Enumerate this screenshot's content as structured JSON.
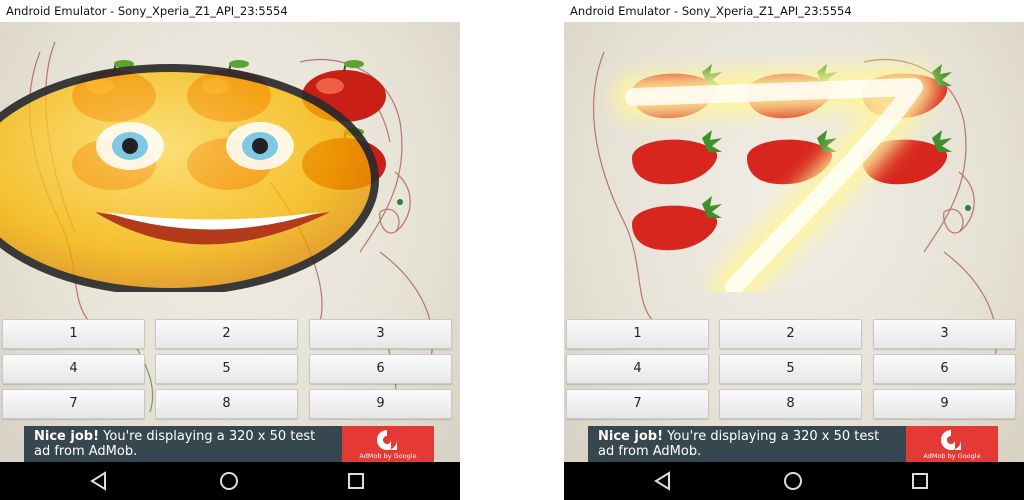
{
  "emulators": [
    {
      "title": "Android Emulator - Sony_Xperia_Z1_API_23:5554",
      "keypad": [
        "1",
        "2",
        "3",
        "4",
        "5",
        "6",
        "7",
        "8",
        "9"
      ],
      "ad": {
        "headline": "Nice job!",
        "body": "You're displaying a 320 x 50 test ad from AdMob.",
        "logo_text": "AdMob by Google"
      },
      "fruit": "apple",
      "fruit_count": 6,
      "overlay": "smiley-face"
    },
    {
      "title": "Android Emulator - Sony_Xperia_Z1_API_23:5554",
      "keypad": [
        "1",
        "2",
        "3",
        "4",
        "5",
        "6",
        "7",
        "8",
        "9"
      ],
      "ad": {
        "headline": "Nice job!",
        "body": "You're displaying a 320 x 50 test ad from AdMob.",
        "logo_text": "AdMob by Google"
      },
      "fruit": "strawberry",
      "fruit_count": 7,
      "overlay": "glowing-number-seven"
    }
  ],
  "nav": {
    "back_icon": "back-triangle-icon",
    "home_icon": "home-circle-icon",
    "recents_icon": "recents-square-icon"
  },
  "colors": {
    "ad_background": "#37474f",
    "ad_logo": "#e53935",
    "navbar": "#000000",
    "glow": "#fff9a8"
  }
}
